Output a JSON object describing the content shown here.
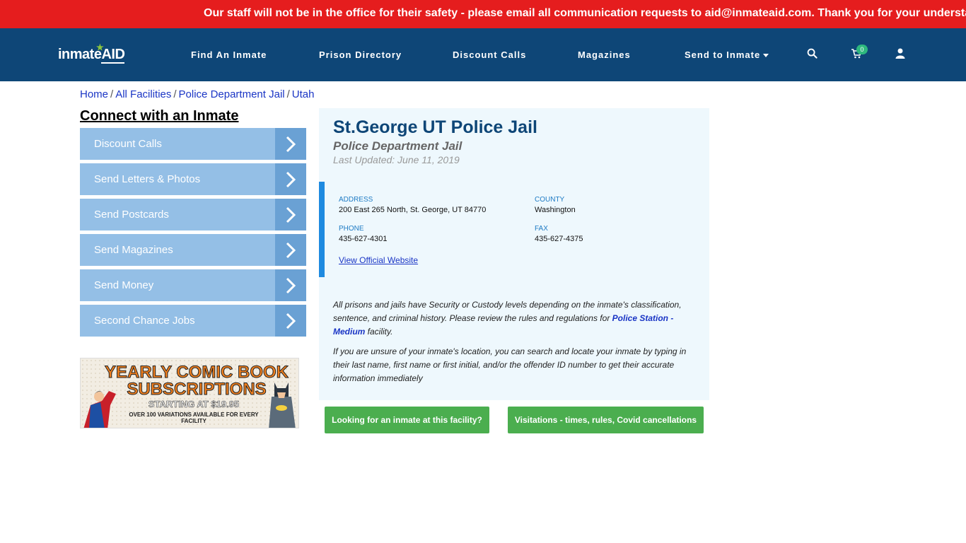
{
  "alert": {
    "text": "Our staff will not be in the office for their safety - please email all communication requests to aid@inmateaid.com. Thank you for your understanding."
  },
  "nav": {
    "logo_inmate": "inmate",
    "logo_aid": "AID",
    "links": [
      "Find An Inmate",
      "Prison Directory",
      "Discount Calls",
      "Magazines",
      "Send to Inmate"
    ],
    "cart_count": "0",
    "icons": [
      "search-icon",
      "cart-icon",
      "user-icon"
    ]
  },
  "breadcrumb": [
    "Home",
    "All Facilities",
    "Police Department Jail",
    "Utah"
  ],
  "sidebar": {
    "title": "Connect with an Inmate",
    "items": [
      "Discount Calls",
      "Send Letters & Photos",
      "Send Postcards",
      "Send Magazines",
      "Send Money",
      "Second Chance Jobs"
    ]
  },
  "banner": {
    "line1": "YEARLY COMIC BOOK",
    "line2": "SUBSCRIPTIONS",
    "line3": "STARTING AT $19.95",
    "line4": "OVER 100 VARIATIONS AVAILABLE FOR EVERY FACILITY"
  },
  "facility": {
    "name": "St.George UT Police Jail",
    "type": "Police Department Jail",
    "updated": "Last Updated: June 11, 2019",
    "address_label": "ADDRESS",
    "address": "200 East 265 North, St. George, UT 84770",
    "county_label": "COUNTY",
    "county": "Washington",
    "phone_label": "PHONE",
    "phone": "435-627-4301",
    "fax_label": "FAX",
    "fax": "435-627-4375",
    "website_link": "View Official Website"
  },
  "paragraphs": {
    "p1_start": "All prisons and jails have Security or Custody levels depending on the inmate's classification, sentence, and criminal history. Please review the rules and regulations for ",
    "p1_bold": "Police Station - Medium",
    "p1_end": " facility.",
    "p2": "If you are unsure of your inmate's location, you can search and locate your inmate by typing in their last name, first name or first initial, and/or the offender ID number to get their accurate information immediately"
  },
  "buttons": {
    "looking": "Looking for an inmate at this facility?",
    "visitations": "Visitations - times, rules, Covid cancellations"
  },
  "colors": {
    "alert_bg": "#e51d1e",
    "nav_bg": "#0e4677",
    "sidebar_btn": "#94bfe6",
    "green_btn": "#4bae4f",
    "panel_bg": "#eef8fd"
  }
}
